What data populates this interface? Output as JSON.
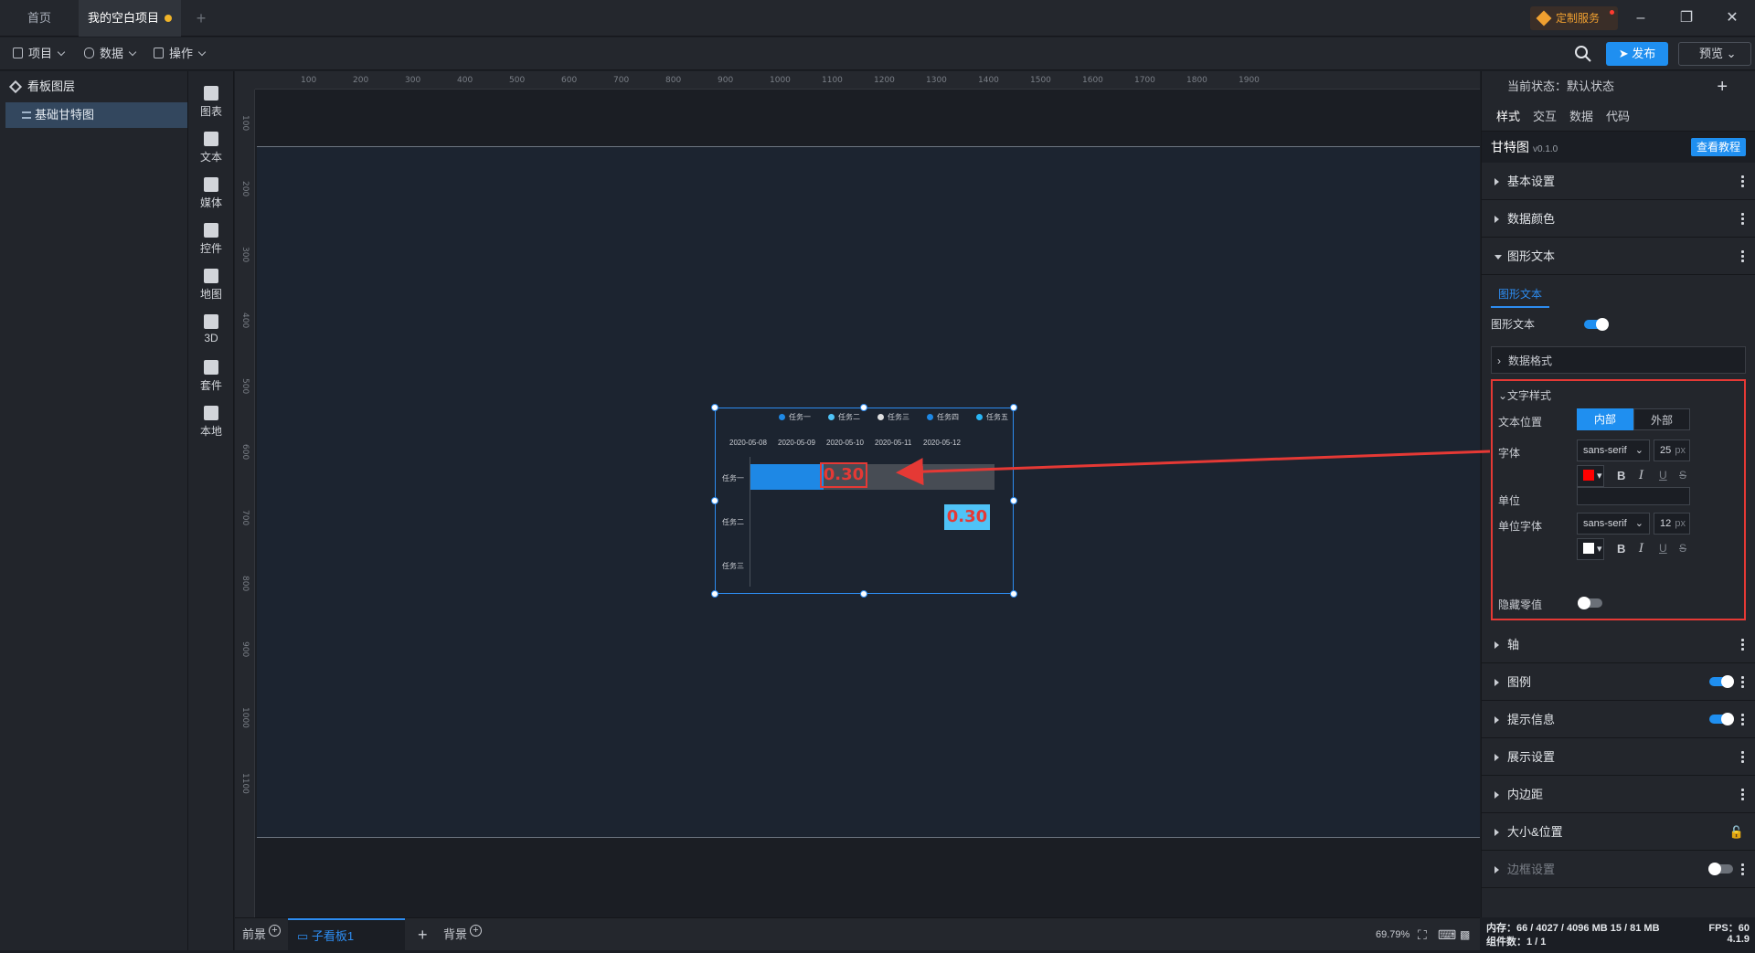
{
  "tabs": {
    "home": "首页",
    "project": "我的空白项目",
    "add": "+"
  },
  "custom_service": "定制服务",
  "toolbar": {
    "project": "项目",
    "data": "数据",
    "ops": "操作",
    "publish": "发布",
    "preview": "预览"
  },
  "layers": {
    "title": "看板图层",
    "item": "基础甘特图"
  },
  "components": [
    "图表",
    "文本",
    "媒体",
    "控件",
    "地图",
    "3D",
    "套件",
    "本地"
  ],
  "ruler": {
    "top": [
      "100",
      "200",
      "300",
      "400",
      "500",
      "600",
      "700",
      "800",
      "900",
      "1000",
      "1100",
      "1200",
      "1300",
      "1400",
      "1500",
      "1600",
      "1700",
      "1800",
      "1900"
    ],
    "left": [
      "100",
      "200",
      "300",
      "400",
      "500",
      "600",
      "700",
      "800",
      "900",
      "1000",
      "1100"
    ]
  },
  "gantt": {
    "legend": [
      "任务一",
      "任务二",
      "任务三",
      "任务四",
      "任务五"
    ],
    "legend_colors": [
      "#1e88e5",
      "#4fc3f7",
      "#e0e0e0",
      "#1e88e5",
      "#29b6f6"
    ],
    "dates": [
      "2020-05-08",
      "2020-05-09",
      "2020-05-10",
      "2020-05-11",
      "2020-05-12"
    ],
    "tasks": [
      "任务一",
      "任务二",
      "任务三"
    ],
    "bar1_label": "0.30",
    "bar2_label": "0.30",
    "bar1_progress": 0.3
  },
  "bottom": {
    "front": "前景",
    "board": "子看板1",
    "add": "+",
    "back": "背景",
    "zoom": "69.79%"
  },
  "right": {
    "state": "当前状态：默认状态",
    "tabs": [
      "样式",
      "交互",
      "数据",
      "代码"
    ],
    "comp_name": "甘特图",
    "comp_ver": "v0.1.0",
    "tutorial": "查看教程",
    "sections_top": [
      "基本设置",
      "数据颜色",
      "图形文本"
    ],
    "inner_tab": "图形文本",
    "graphic_text_label": "图形文本",
    "data_format": "数据格式",
    "text_style": "文字样式",
    "text_pos": "文本位置",
    "pos_inner": "内部",
    "pos_outer": "外部",
    "font": "字体",
    "font_family": "sans-serif",
    "font_size": "25",
    "px": "px",
    "font_color": "#ff0000",
    "unit": "单位",
    "unit_value": "",
    "unit_font": "单位字体",
    "unit_font_family": "sans-serif",
    "unit_font_size": "12",
    "unit_color": "#ffffff",
    "hide_zero": "隐藏零值",
    "sections_bottom": [
      "轴",
      "图例",
      "提示信息",
      "展示设置",
      "内边距",
      "大小&位置",
      "边框设置"
    ]
  },
  "status": {
    "mem": "内存：66 / 4027 / 4096 MB  15 / 81 MB",
    "fps": "FPS：60",
    "count": "组件数：1 / 1",
    "ver": "4.1.9"
  }
}
